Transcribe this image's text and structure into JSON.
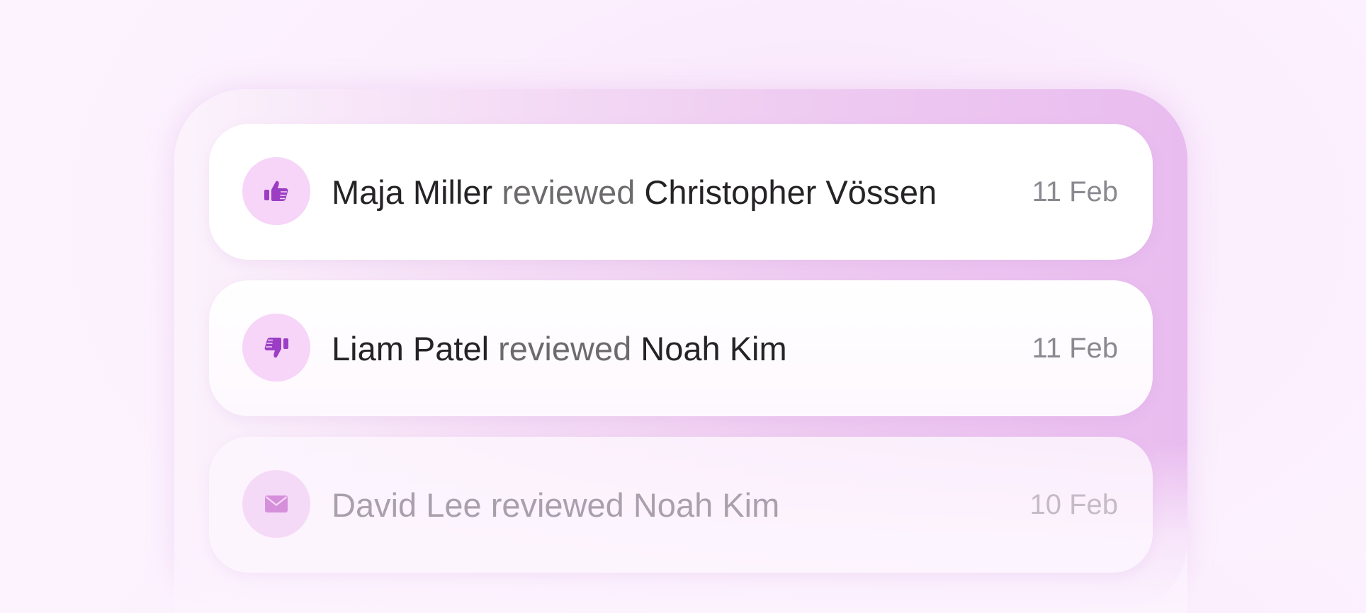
{
  "colors": {
    "accent": "#9b3ec4",
    "icon_bg": "#f6d5f8",
    "name_text": "#262326",
    "verb_text": "#6d6a6e",
    "date_text": "#8b8990"
  },
  "feed": {
    "items": [
      {
        "icon": "thumbs-up-icon",
        "actor": "Maja Miller",
        "verb": "reviewed",
        "subject": "Christopher Vössen",
        "date": "11 Feb"
      },
      {
        "icon": "thumbs-down-icon",
        "actor": "Liam Patel",
        "verb": "reviewed",
        "subject": "Noah Kim",
        "date": "11 Feb"
      },
      {
        "icon": "envelope-icon",
        "actor": "David Lee",
        "verb": "reviewed",
        "subject": "Noah Kim",
        "date": "10 Feb"
      }
    ]
  }
}
